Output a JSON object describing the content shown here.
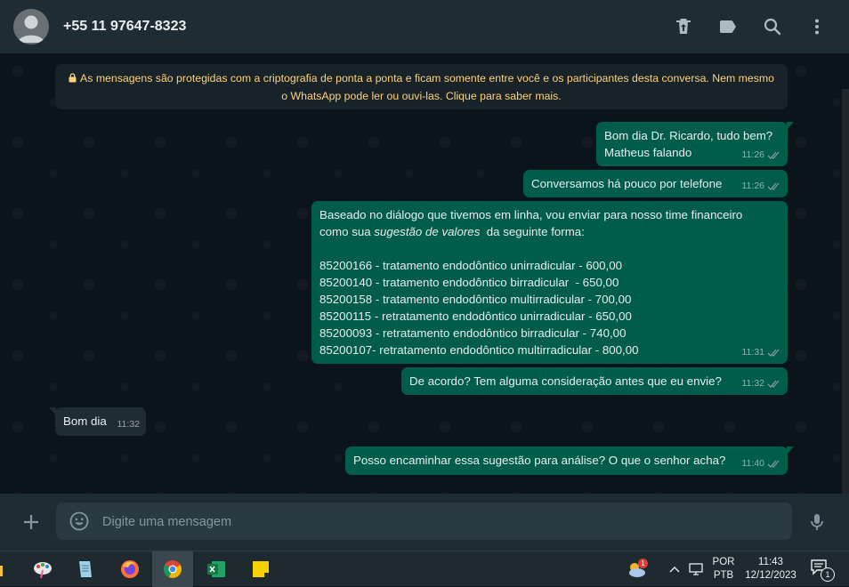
{
  "header": {
    "contact_name": "+55 11 97647-8323"
  },
  "encryption_notice": {
    "line1": "As mensagens são protegidas com a criptografia de ponta a ponta e ficam somente entre você e os participantes desta conversa. Nem mesmo",
    "line2": "o WhatsApp pode ler ou ouvi-las. Clique para saber mais."
  },
  "messages": [
    {
      "direction": "out",
      "lines": [
        "Bom dia Dr. Ricardo, tudo bem?",
        "Matheus falando"
      ],
      "time": "11:26"
    },
    {
      "direction": "out",
      "lines": [
        "Conversamos há pouco por telefone"
      ],
      "time": "11:26"
    },
    {
      "direction": "out",
      "intro_line1": "Baseado no diálogo que tivemos em linha, vou enviar para nosso time financeiro",
      "intro_line2_before": "como sua ",
      "intro_line2_em": "sugestão de valores",
      "intro_line2_after": "  da seguinte forma:",
      "items": [
        "85200166 - tratamento endodôntico unirradicular - 600,00",
        "85200140 - tratamento endodôntico birradicular  - 650,00",
        "85200158 - tratamento endodôntico multirradicular - 700,00",
        "85200115 - retratamento endodôntico unirradicular - 650,00",
        "85200093 - retratamento endodôntico birradicular - 740,00",
        "85200107- retratamento endodôntico multirradicular - 800,00"
      ],
      "time": "11:31"
    },
    {
      "direction": "out",
      "lines": [
        "De acordo? Tem alguma consideração antes que eu envie?"
      ],
      "time": "11:32"
    },
    {
      "direction": "in",
      "lines": [
        "Bom dia"
      ],
      "time": "11:32"
    },
    {
      "direction": "out",
      "lines": [
        "Posso encaminhar essa sugestão para análise? O que o senhor acha?"
      ],
      "time": "11:40"
    }
  ],
  "composer": {
    "placeholder": "Digite uma mensagem"
  },
  "taskbar": {
    "weather_badge": "1",
    "language_line1": "POR",
    "language_line2": "PTB",
    "clock_time": "11:43",
    "clock_date": "12/12/2023",
    "notification_count": "1"
  },
  "colors": {
    "outgoing_bubble": "#005c4b",
    "incoming_bubble": "#202c33",
    "encryption_text": "#ffd279",
    "read_ticks": "#8696a0"
  }
}
